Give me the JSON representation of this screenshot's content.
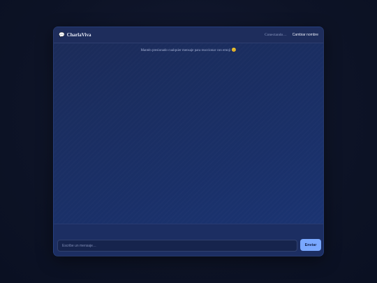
{
  "header": {
    "icon": "speech-bubble-icon",
    "title": "CharlaViva",
    "status": "Conectando…",
    "rename_label": "Cambiar nombre"
  },
  "messages": {
    "hint": "Mantén presionado cualquier mensaje para reaccionar con emoji",
    "hint_emoji": "😊"
  },
  "composer": {
    "placeholder": "Escribe un mensaje…",
    "value": "",
    "send_label": "Enviar"
  },
  "colors": {
    "accent": "#7aa8ff",
    "panel": "#1b2b58",
    "page_background": "#0d1326"
  }
}
